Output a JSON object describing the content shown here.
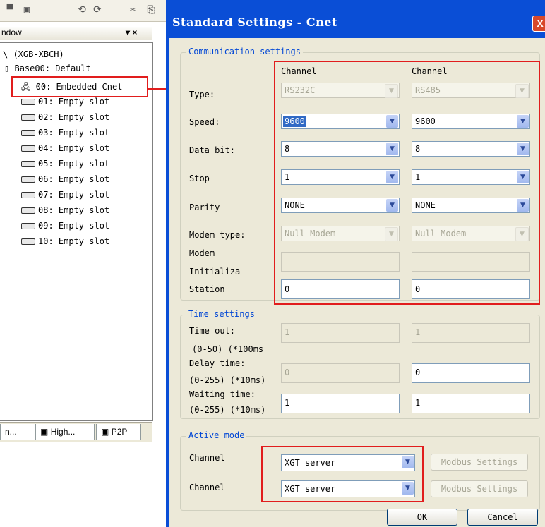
{
  "toolbar": {
    "icons": [
      "save-icon",
      "print-icon",
      "undo-icon",
      "redo-icon",
      "cut-icon",
      "copy-icon"
    ],
    "glyphs": [
      "▀",
      "▣",
      "⟲",
      "⟳",
      "✂",
      "⎘"
    ]
  },
  "project_window": {
    "title": "ndow",
    "controls": "▾ ×",
    "tree": {
      "root": "\\ (XGB-XBCH)",
      "base": "Base00: Default",
      "items": [
        "00: Embedded Cnet",
        "01: Empty slot",
        "02: Empty slot",
        "03: Empty slot",
        "04: Empty slot",
        "05: Empty slot",
        "06: Empty slot",
        "07: Empty slot",
        "08: Empty slot",
        "09: Empty slot",
        "10: Empty slot"
      ]
    },
    "tabs": [
      "n...",
      "High...",
      "P2P"
    ]
  },
  "dialog": {
    "title": "Standard Settings - Cnet",
    "close_label": "X",
    "communication": {
      "title": "Communication settings",
      "col1_header": "Channel",
      "col2_header": "Channel",
      "labels": {
        "type": "Type:",
        "speed": "Speed:",
        "data_bit": "Data bit:",
        "stop": "Stop",
        "parity": "Parity",
        "modem_type": "Modem type:",
        "modem_line1": "Modem",
        "modem_line2": "Initializa",
        "station": "Station"
      },
      "ch1": {
        "type": "RS232C",
        "speed": "9600",
        "data_bit": "8",
        "stop": "1",
        "parity": "NONE",
        "modem_type": "Null Modem",
        "modem_init": "",
        "station": "0"
      },
      "ch2": {
        "type": "RS485",
        "speed": "9600",
        "data_bit": "8",
        "stop": "1",
        "parity": "NONE",
        "modem_type": "Null Modem",
        "modem_init": "",
        "station": "0"
      }
    },
    "time": {
      "title": "Time settings",
      "timeout_label": "Time out:",
      "timeout_range": "(0-50) (*100ms",
      "delay_label": "Delay time:",
      "delay_range": "(0-255) (*10ms)",
      "waiting_label": "Waiting time:",
      "waiting_range": "(0-255) (*10ms)",
      "ch1": {
        "timeout": "1",
        "delay": "0",
        "waiting": "1"
      },
      "ch2": {
        "timeout": "1",
        "delay": "0",
        "waiting": "1"
      }
    },
    "active": {
      "title": "Active mode",
      "row1_label": "Channel",
      "row2_label": "Channel",
      "row1_value": "XGT server",
      "row2_value": "XGT server",
      "modbus_label": "Modbus Settings"
    },
    "ok_label": "OK",
    "cancel_label": "Cancel"
  },
  "colors": {
    "annotation": "#e11d1d",
    "title_bar": "#0a4ed6",
    "group_title": "#0046d5"
  }
}
